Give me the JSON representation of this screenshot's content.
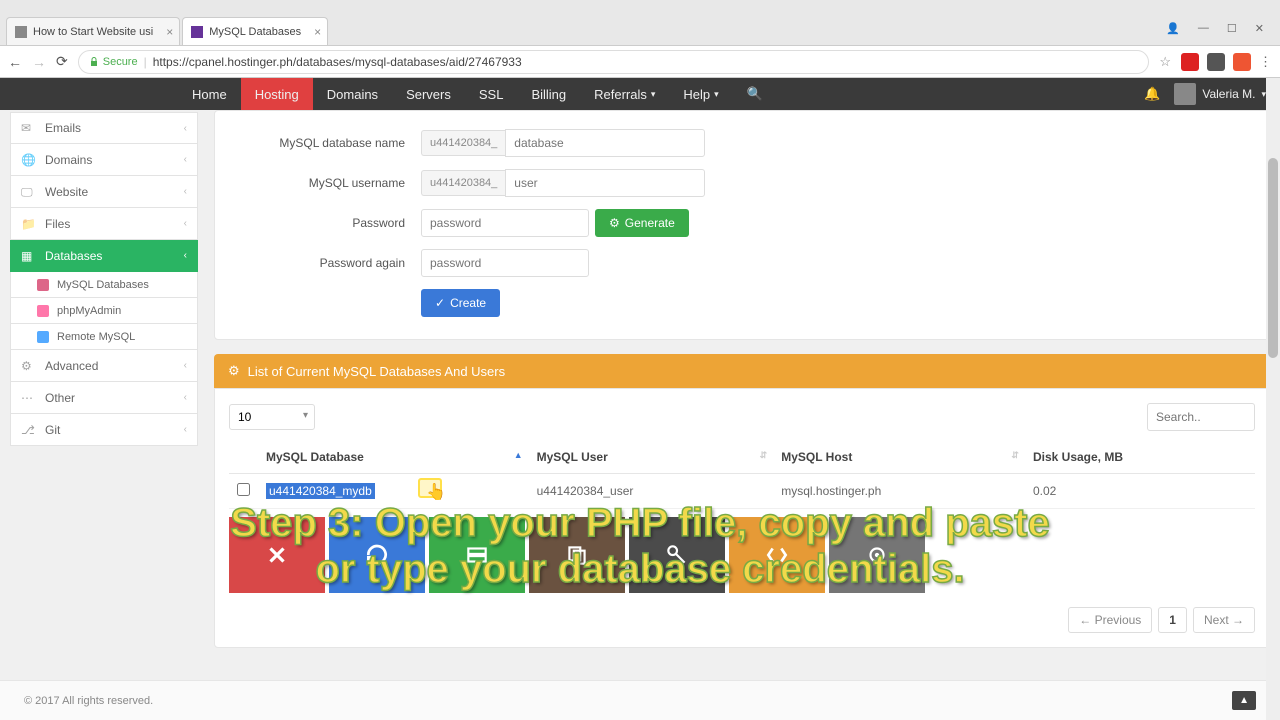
{
  "tabs": [
    {
      "title": "How to Start Website usi"
    },
    {
      "title": "MySQL Databases"
    }
  ],
  "address": {
    "secure_label": "Secure",
    "url": "https://cpanel.hostinger.ph/databases/mysql-databases/aid/27467933"
  },
  "nav": {
    "items": [
      "Home",
      "Hosting",
      "Domains",
      "Servers",
      "SSL",
      "Billing",
      "Referrals",
      "Help"
    ],
    "user": "Valeria M."
  },
  "sidebar": {
    "items": [
      "Emails",
      "Domains",
      "Website",
      "Files",
      "Databases",
      "Advanced",
      "Other",
      "Git"
    ],
    "sub": [
      "MySQL Databases",
      "phpMyAdmin",
      "Remote MySQL"
    ]
  },
  "form": {
    "db_label": "MySQL database name",
    "prefix": "u441420384_",
    "db_ph": "database",
    "user_label": "MySQL username",
    "user_ph": "user",
    "pass_label": "Password",
    "pass_ph": "password",
    "pass2_label": "Password again",
    "generate": "Generate",
    "create": "Create"
  },
  "list": {
    "title": "List of Current MySQL Databases And Users",
    "page_size": "10",
    "search_ph": "Search..",
    "columns": [
      "MySQL Database",
      "MySQL User",
      "MySQL Host",
      "Disk Usage, MB"
    ],
    "row": {
      "db_sel": "u441420384_mydb",
      "user": "u441420384_user",
      "host": "mysql.hostinger.ph",
      "disk": "0.02"
    },
    "prev": "← Previous",
    "page": "1",
    "next": "Next →"
  },
  "footer": "© 2017 All rights reserved.",
  "overlay_line1": "Step 3: Open your PHP file, copy and paste",
  "overlay_line2": "or type your database credentials."
}
